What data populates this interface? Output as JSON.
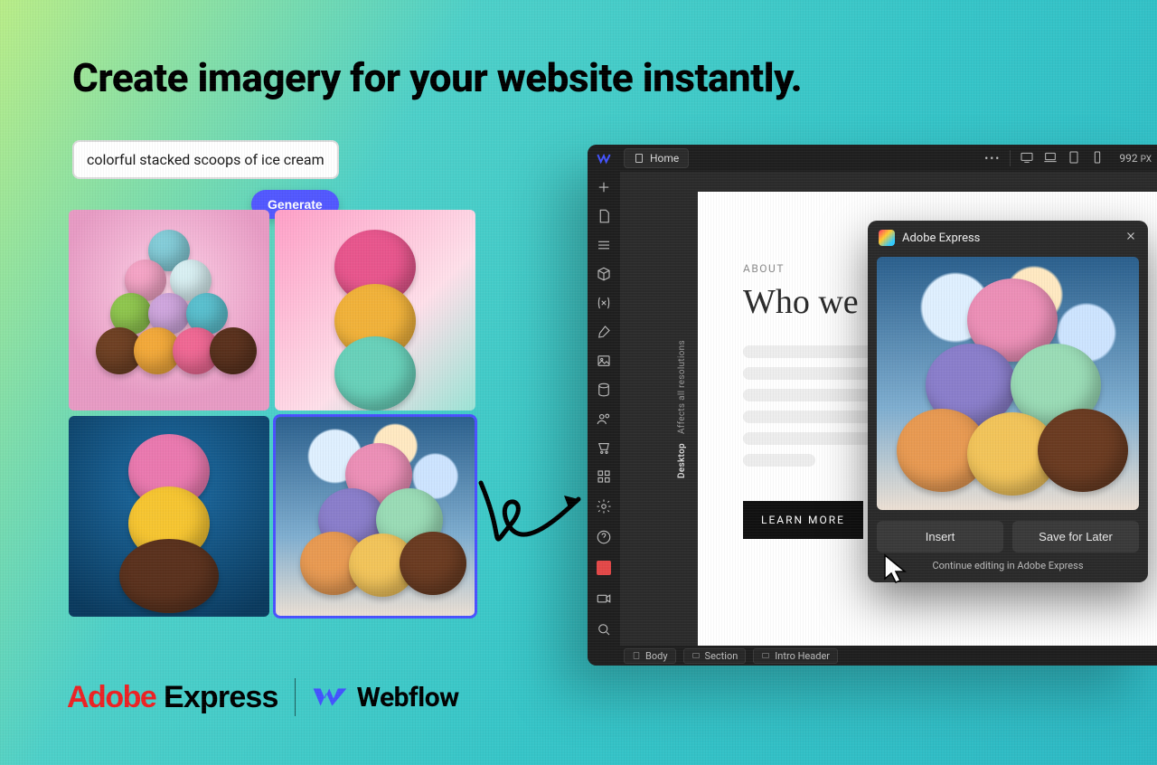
{
  "headline": "Create imagery for your website instantly.",
  "prompt": {
    "value": "colorful stacked scoops of ice cream"
  },
  "generate_label": "Generate",
  "editor": {
    "home_label": "Home",
    "viewport_px": "992",
    "viewport_unit": "PX",
    "tab_strip": {
      "mode": "Desktop",
      "hint": "Affects all resolutions"
    },
    "page": {
      "about_label": "ABOUT",
      "heading": "Who we are",
      "learn_more": "LEARN MORE"
    },
    "breadcrumbs": [
      "Body",
      "Section",
      "Intro Header"
    ]
  },
  "panel": {
    "title": "Adobe Express",
    "insert": "Insert",
    "save": "Save for Later",
    "continue": "Continue editing in Adobe Express"
  },
  "footer": {
    "adobe": "Adobe",
    "express": "Express",
    "webflow": "Webflow"
  }
}
